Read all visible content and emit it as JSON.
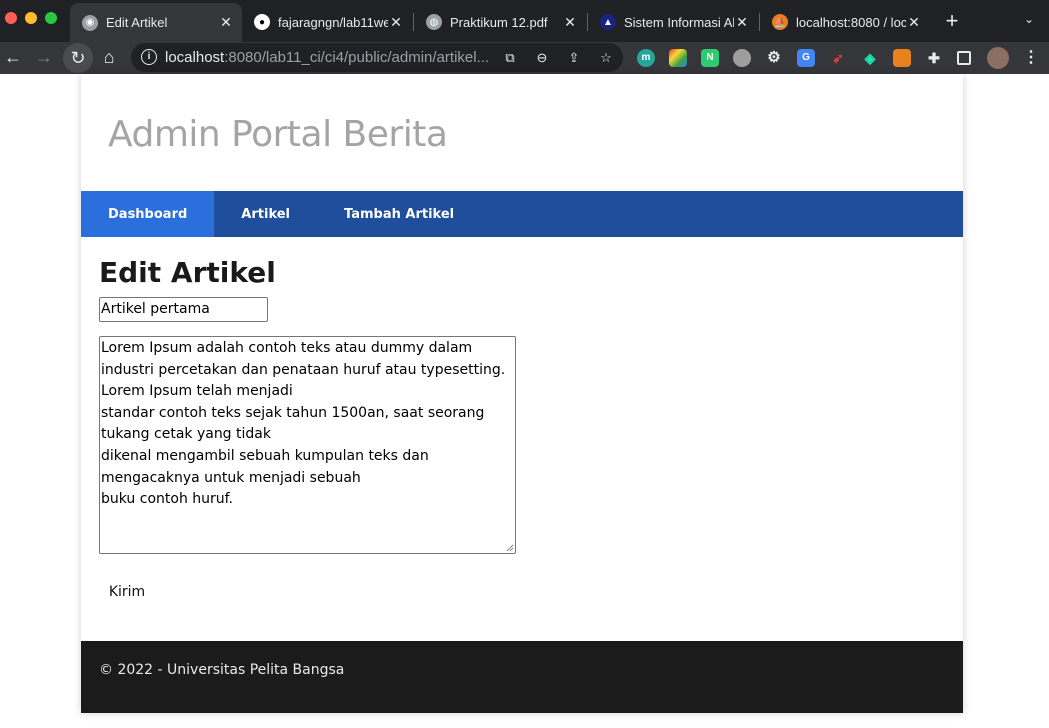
{
  "browser": {
    "tabs": [
      {
        "title": "Edit Artikel",
        "active": true
      },
      {
        "title": "fajaragngn/lab11web",
        "active": false
      },
      {
        "title": "Praktikum 12.pdf",
        "active": false
      },
      {
        "title": "Sistem Informasi Ak",
        "active": false
      },
      {
        "title": "localhost:8080 / loc",
        "active": false
      }
    ],
    "new_tab_label": "+",
    "address": {
      "host": "localhost",
      "path": ":8080/lab11_ci/ci4/public/admin/artikel..."
    },
    "extensions": [
      "m",
      "colorwheel",
      "N",
      "cloud",
      "gear",
      "G",
      "rocket",
      "diamond",
      "fox",
      "puzzle"
    ]
  },
  "site": {
    "title": "Admin Portal Berita",
    "nav": [
      {
        "label": "Dashboard",
        "active": true
      },
      {
        "label": "Artikel",
        "active": false
      },
      {
        "label": "Tambah Artikel",
        "active": false
      }
    ]
  },
  "form": {
    "heading": "Edit Artikel",
    "title_value": "Artikel pertama",
    "body_value": "Lorem Ipsum adalah contoh teks atau dummy dalam industri percetakan dan penataan huruf atau typesetting. Lorem Ipsum telah menjadi\nstandar contoh teks sejak tahun 1500an, saat seorang tukang cetak yang tidak\ndikenal mengambil sebuah kumpulan teks dan mengacaknya untuk menjadi sebuah\nbuku contoh huruf.",
    "submit_label": "Kirim"
  },
  "footer": {
    "text": "© 2022 - Universitas Pelita Bangsa"
  },
  "colors": {
    "nav_bg": "#1f4e9c",
    "nav_active": "#2a6fdb",
    "footer_bg": "#1b1b1b",
    "title_gray": "#a4a4a4"
  }
}
